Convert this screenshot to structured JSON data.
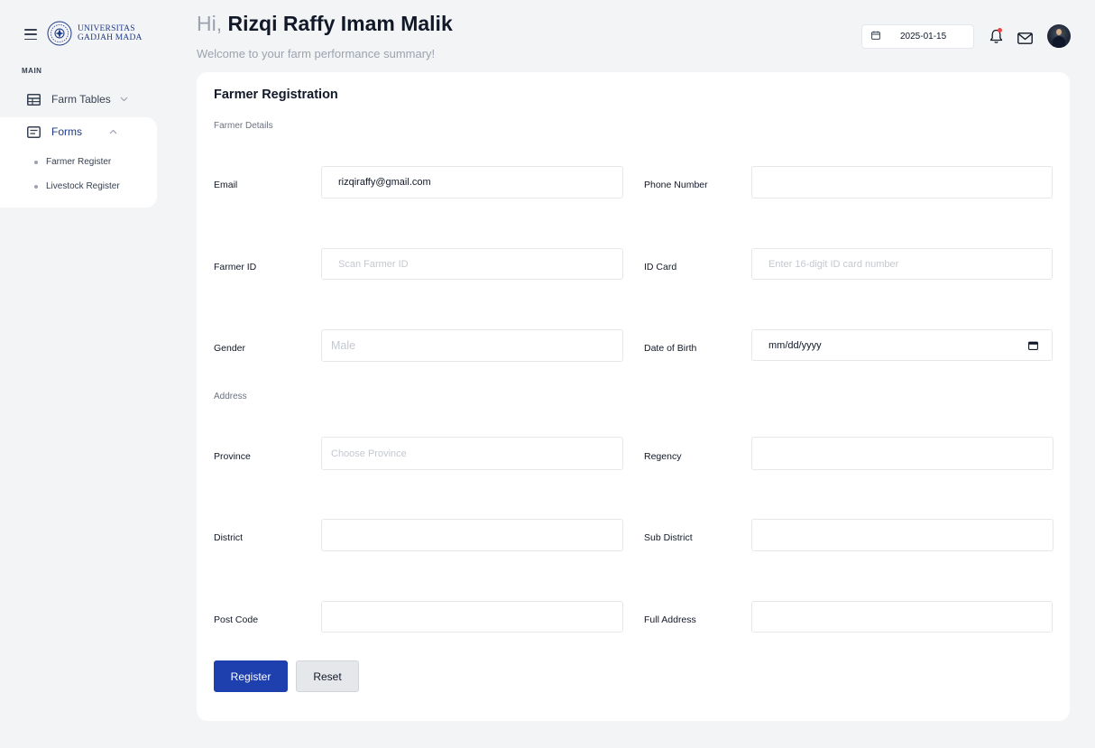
{
  "brand": {
    "logo_line1": "UNIVERSITAS",
    "logo_line2": "GADJAH MADA",
    "primary_color": "#1e3fae"
  },
  "sidebar": {
    "section_label": "MAIN",
    "items": [
      {
        "label": "Farm Tables",
        "icon": "table-icon",
        "expanded": false
      },
      {
        "label": "Forms",
        "icon": "form-icon",
        "expanded": true,
        "children": [
          {
            "label": "Farmer Register"
          },
          {
            "label": "Livestock Register"
          }
        ]
      }
    ]
  },
  "header": {
    "greeting_prefix": "Hi,",
    "user_name": "Rizqi Raffy Imam Malik",
    "subtitle": "Welcome to your farm performance summary!",
    "date": "2025-01-15"
  },
  "form": {
    "title": "Farmer Registration",
    "details_label": "Farmer Details",
    "address_label": "Address",
    "fields": {
      "email": {
        "label": "Email",
        "value": "rizqiraffy@gmail.com",
        "placeholder": ""
      },
      "phone": {
        "label": "Phone Number",
        "value": "",
        "placeholder": ""
      },
      "farmer_id": {
        "label": "Farmer ID",
        "value": "",
        "placeholder": "Scan Farmer ID"
      },
      "id_card": {
        "label": "ID Card",
        "value": "",
        "placeholder": "Enter 16-digit ID card number"
      },
      "gender": {
        "label": "Gender",
        "value": "",
        "placeholder": "Male"
      },
      "dob": {
        "label": "Date of Birth",
        "value": "mm/dd/yyyy"
      },
      "province": {
        "label": "Province",
        "value": "",
        "placeholder": "Choose Province"
      },
      "regency": {
        "label": "Regency",
        "value": "",
        "placeholder": ""
      },
      "district": {
        "label": "District",
        "value": "",
        "placeholder": ""
      },
      "sub_district": {
        "label": "Sub District",
        "value": "",
        "placeholder": ""
      },
      "post_code": {
        "label": "Post Code",
        "value": "",
        "placeholder": ""
      },
      "full_address": {
        "label": "Full Address",
        "value": "",
        "placeholder": ""
      }
    },
    "register_label": "Register",
    "reset_label": "Reset"
  }
}
